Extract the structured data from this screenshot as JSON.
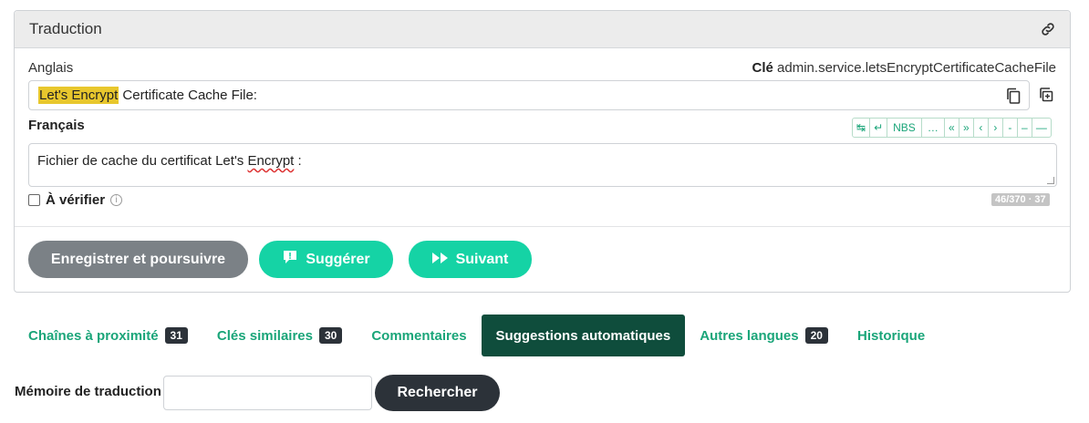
{
  "panel": {
    "title": "Traduction",
    "link_icon": "link-icon"
  },
  "source": {
    "language_label": "Anglais",
    "key_label": "Clé",
    "key_value": "admin.service.letsEncryptCertificateCacheFile",
    "text_highlight": "Let's Encrypt",
    "text_rest": " Certificate Cache File:",
    "copy_icon": "copy-icon",
    "clone_icon": "clone-icon"
  },
  "target": {
    "language_label": "Français",
    "text_before": "Fichier de cache du certificat Let's ",
    "text_misspelled": "Encrypt",
    "text_after": " :",
    "verify_label": "À vérifier",
    "counter": "46/370 · 37"
  },
  "toolbar": {
    "buttons": [
      "↹",
      "↵",
      "NBS",
      "…",
      "«",
      "»",
      "‹",
      "›",
      "-",
      "–",
      "—"
    ]
  },
  "actions": {
    "save_label": "Enregistrer et poursuivre",
    "suggest_label": "Suggérer",
    "next_label": "Suivant"
  },
  "tabs": [
    {
      "label": "Chaînes à proximité",
      "count": "31",
      "active": false
    },
    {
      "label": "Clés similaires",
      "count": "30",
      "active": false
    },
    {
      "label": "Commentaires",
      "count": "",
      "active": false
    },
    {
      "label": "Suggestions automatiques",
      "count": "",
      "active": true
    },
    {
      "label": "Autres langues",
      "count": "20",
      "active": false
    },
    {
      "label": "Historique",
      "count": "",
      "active": false
    }
  ],
  "memory": {
    "label": "Mémoire de traduction",
    "input_value": "",
    "search_label": "Rechercher"
  },
  "colors": {
    "accent": "#15d3a5",
    "accent_text": "#1aa579",
    "active_tab": "#0f4d3c",
    "highlight": "#e8c72d",
    "dark": "#2c3239"
  }
}
